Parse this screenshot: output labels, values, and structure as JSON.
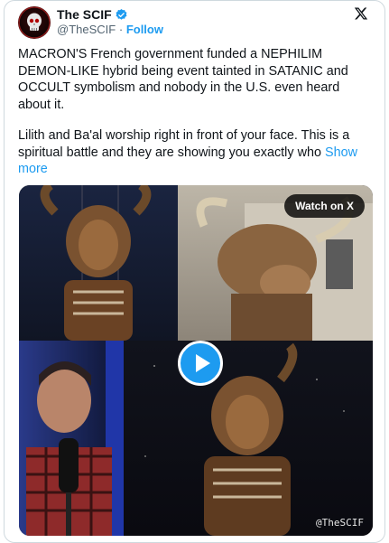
{
  "author": {
    "display_name": "The SCIF",
    "handle": "@TheSCIF",
    "separator": "·",
    "follow_label": "Follow"
  },
  "post": {
    "paragraph_1": "MACRON'S French government funded a NEPHILIM DEMON-LIKE hybrid being event tainted in SATANIC and OCCULT symbolism and nobody in the U.S. even heard about it.",
    "paragraph_2": "Lilith and Ba'al worship right in front of your face. This is a spiritual battle and they are showing you exactly who",
    "show_more_label": "Show more"
  },
  "media": {
    "watch_label": "Watch on X",
    "watermark": "@TheSCIF"
  },
  "icons": {
    "verified": "verified-badge-icon",
    "platform": "x-logo-icon",
    "play": "play-icon"
  },
  "colors": {
    "accent": "#1d9bf0",
    "text": "#0f1419",
    "muted": "#536471",
    "border": "#cfd9de"
  }
}
